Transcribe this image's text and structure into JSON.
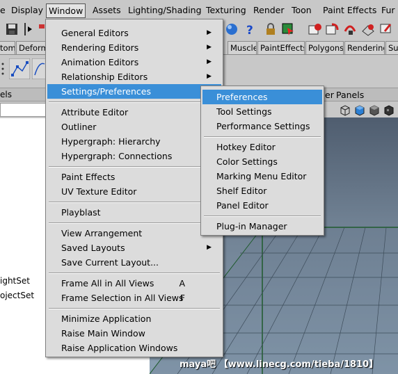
{
  "menubar": {
    "items": [
      "e",
      "Display",
      "Window",
      "Assets",
      "Lighting/Shading",
      "Texturing",
      "Render",
      "Toon",
      "Paint Effects",
      "Fur"
    ]
  },
  "shelf": {
    "tabs_left": [
      "tom",
      "Deforma"
    ],
    "tabs_right": [
      "Muscle",
      "PaintEffects",
      "Polygons",
      "Rendering",
      "Su"
    ]
  },
  "left_panel": {
    "header": "els",
    "list_items": [
      "ightSet",
      "ojectSet"
    ]
  },
  "viewport": {
    "header_menus": [
      "er",
      "Panels"
    ]
  },
  "window_menu": {
    "items": [
      {
        "label": "General Editors",
        "submenu": true
      },
      {
        "label": "Rendering Editors",
        "submenu": true
      },
      {
        "label": "Animation Editors",
        "submenu": true
      },
      {
        "label": "Relationship Editors",
        "submenu": true
      },
      {
        "label": "Settings/Preferences",
        "submenu": true,
        "highlighted": true
      },
      {
        "label": "Attribute Editor"
      },
      {
        "label": "Outliner"
      },
      {
        "label": "Hypergraph: Hierarchy"
      },
      {
        "label": "Hypergraph: Connections"
      },
      {
        "label": "Paint Effects"
      },
      {
        "label": "UV Texture Editor"
      },
      {
        "label": "Playblast"
      },
      {
        "label": "View Arrangement",
        "submenu": true
      },
      {
        "label": "Saved Layouts",
        "submenu": true
      },
      {
        "label": "Save Current Layout..."
      },
      {
        "label": "Frame All in All Views",
        "accel": "A"
      },
      {
        "label": "Frame Selection in All Views",
        "accel": "F"
      },
      {
        "label": "Minimize Application"
      },
      {
        "label": "Raise Main Window"
      },
      {
        "label": "Raise Application Windows"
      }
    ]
  },
  "settings_submenu": {
    "items": [
      {
        "label": "Preferences",
        "highlighted": true
      },
      {
        "label": "Tool Settings"
      },
      {
        "label": "Performance Settings"
      },
      {
        "label": "Hotkey Editor"
      },
      {
        "label": "Color Settings"
      },
      {
        "label": "Marking Menu Editor"
      },
      {
        "label": "Shelf Editor"
      },
      {
        "label": "Panel Editor"
      },
      {
        "label": "Plug-in Manager"
      }
    ]
  },
  "watermark": "maya吧 【www.linecg.com/tieba/1810】",
  "colors": {
    "highlight": "#3a8fd8",
    "menu_bg": "#dcdcdc",
    "ui_bg": "#c8c8c8",
    "grid_line": "#1e5a2c"
  }
}
